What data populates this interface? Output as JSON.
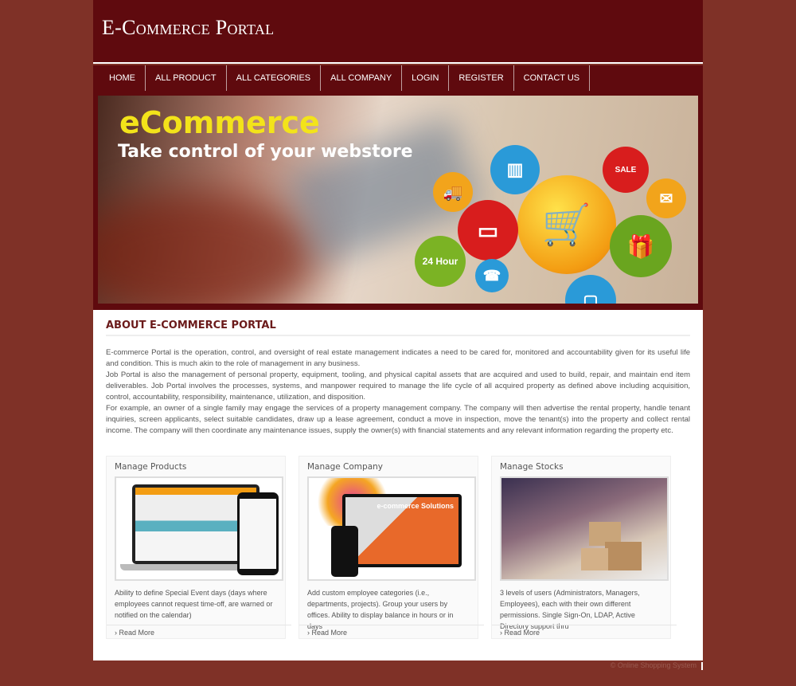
{
  "header": {
    "title": "E-Commerce Portal"
  },
  "nav": [
    "HOME",
    "ALL PRODUCT",
    "ALL CATEGORIES",
    "ALL COMPANY",
    "LOGIN",
    "REGISTER",
    "CONTACT US"
  ],
  "banner": {
    "headline": "eCommerce",
    "tagline": "Take control of your webstore",
    "badge": "24 Hour",
    "sale": "SALE"
  },
  "about": {
    "heading": "ABOUT E-COMMERCE PORTAL",
    "paragraphs": [
      "E-commerce Portal is the operation, control, and oversight of real estate management indicates a need to be cared for, monitored and accountability given for its useful life and condition. This is much akin to the role of management in any business.",
      "Job Portal is also the management of personal property, equipment, tooling, and physical capital assets that are acquired and used to build, repair, and maintain end item deliverables. Job Portal involves the processes, systems, and manpower required to manage the life cycle of all acquired property as defined above including acquisition, control, accountability, responsibility, maintenance, utilization, and disposition.",
      "For example, an owner of a single family may engage the services of a property management company. The company will then advertise the rental property, handle tenant inquiries, screen applicants, select suitable candidates, draw up a lease agreement, conduct a move in inspection, move the tenant(s) into the property and collect rental income. The company will then coordinate any maintenance issues, supply the owner(s) with financial statements and any relevant information regarding the property etc."
    ]
  },
  "cards": [
    {
      "title": "Manage Products",
      "text": "Ability to define Special Event days (days where employees cannot request time-off, are warned or notified on the calendar)",
      "more": "Read More"
    },
    {
      "title": "Manage Company",
      "text": "Add custom employee categories (i.e., departments, projects). Group your users by offices. Ability to display balance in hours or in days",
      "more": "Read More",
      "image_text": "e-commerce Solutions"
    },
    {
      "title": "Manage Stocks",
      "text": "3 levels of users (Administrators, Managers, Employees), each with their own different permissions. Single Sign-On, LDAP, Active Directory support thru",
      "more": "Read More"
    }
  ],
  "footer": {
    "copyright": "© Online Shopping System"
  },
  "colors": {
    "page_bg": "#7f3127",
    "header_bg": "#5f0a0e",
    "heading": "#6b1a1a"
  }
}
